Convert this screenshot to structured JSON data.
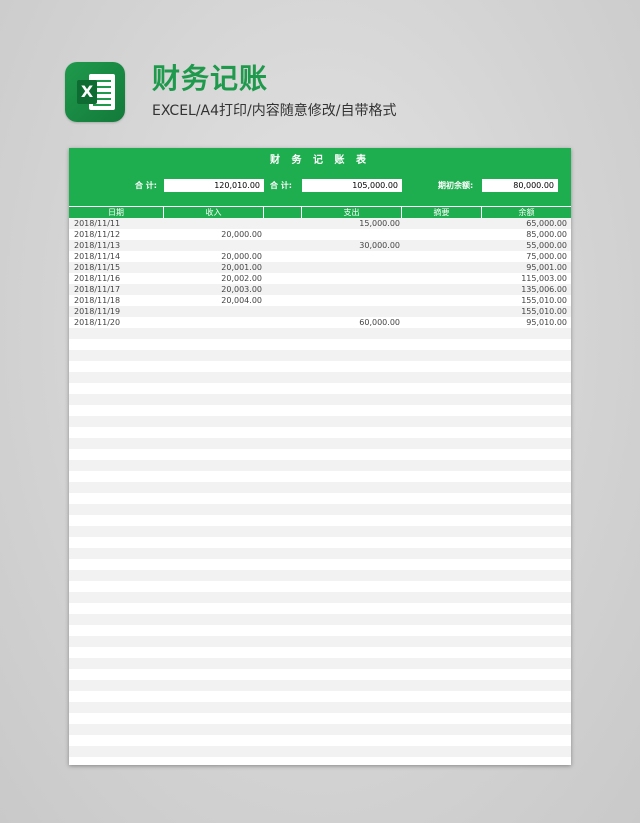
{
  "header": {
    "logo_letter": "X",
    "title": "财务记账",
    "subtitle": "EXCEL/A4打印/内容随意修改/自带格式"
  },
  "sheet": {
    "title": "财 务 记 账 表",
    "summary": {
      "income_label": "合 计:",
      "income_total": "120,010.00",
      "expense_label": "合 计:",
      "expense_total": "105,000.00",
      "opening_label": "期初余额:",
      "opening_balance": "80,000.00"
    },
    "columns": {
      "date": "日期",
      "income": "收入",
      "expense": "支出",
      "note": "摘要",
      "balance": "余额"
    },
    "rows": [
      {
        "date": "2018/11/11",
        "income": "",
        "expense": "15,000.00",
        "note": "",
        "balance": "65,000.00"
      },
      {
        "date": "2018/11/12",
        "income": "20,000.00",
        "expense": "",
        "note": "",
        "balance": "85,000.00"
      },
      {
        "date": "2018/11/13",
        "income": "",
        "expense": "30,000.00",
        "note": "",
        "balance": "55,000.00"
      },
      {
        "date": "2018/11/14",
        "income": "20,000.00",
        "expense": "",
        "note": "",
        "balance": "75,000.00"
      },
      {
        "date": "2018/11/15",
        "income": "20,001.00",
        "expense": "",
        "note": "",
        "balance": "95,001.00"
      },
      {
        "date": "2018/11/16",
        "income": "20,002.00",
        "expense": "",
        "note": "",
        "balance": "115,003.00"
      },
      {
        "date": "2018/11/17",
        "income": "20,003.00",
        "expense": "",
        "note": "",
        "balance": "135,006.00"
      },
      {
        "date": "2018/11/18",
        "income": "20,004.00",
        "expense": "",
        "note": "",
        "balance": "155,010.00"
      },
      {
        "date": "2018/11/19",
        "income": "",
        "expense": "",
        "note": "",
        "balance": "155,010.00"
      },
      {
        "date": "2018/11/20",
        "income": "",
        "expense": "60,000.00",
        "note": "",
        "balance": "95,010.00"
      }
    ]
  },
  "colors": {
    "brand_green": "#1fae4f",
    "title_green": "#1f9a4c",
    "stripe_gray": "#f2f2f2"
  }
}
